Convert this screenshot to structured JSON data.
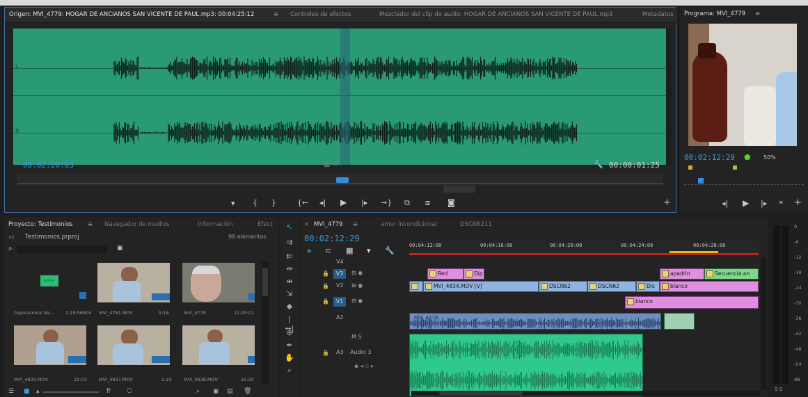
{
  "source": {
    "tabs": [
      {
        "label": "Origen: MVI_4779: HOGAR DE ANCIANOS SAN VICENTE DE PAUL.mp3: 00:04:25:12",
        "active": true
      },
      {
        "label": "Controles de efectos",
        "active": false
      },
      {
        "label": "Mezclador del clip de audio: HOGAR DE ANCIANOS SAN VICENTE DE PAUL.mp3",
        "active": false
      },
      {
        "label": "Metadatos",
        "active": false
      }
    ],
    "menu_icon": "≡",
    "channel_labels": [
      "L",
      "R"
    ],
    "timecode_left": "00:02:20:03",
    "timecode_right": "00:00:01:25",
    "waveform_color": "#2a9a76"
  },
  "program": {
    "tab": "Programa: MVI_4779",
    "menu_icon": "≡",
    "timecode": "00:02:12:29",
    "zoom": "50%"
  },
  "project": {
    "tabs": [
      {
        "label": "Proyecto: Testimonios",
        "active": true
      },
      {
        "label": "Navegador de medios",
        "active": false
      },
      {
        "label": "Información",
        "active": false
      },
      {
        "label": "Efect",
        "active": false
      }
    ],
    "menu_icon": "≡",
    "file": "Testimonios.prproj",
    "count": "98 elementos",
    "items": [
      {
        "name": "Depinational Ba...",
        "duration": "2:19:06804"
      },
      {
        "name": "MVI_4781.MOV",
        "duration": "9:18"
      },
      {
        "name": "MVI_4779",
        "duration": "12:25:01"
      },
      {
        "name": "MVI_4834.MOV",
        "duration": "22:03"
      },
      {
        "name": "MVI_4837.MOV",
        "duration": "2:23"
      },
      {
        "name": "MVI_4838.MOV",
        "duration": "15:20"
      }
    ]
  },
  "timeline": {
    "tabs": [
      {
        "label": "MVI_4779",
        "active": true
      },
      {
        "label": "amor incondicional",
        "active": false
      },
      {
        "label": "DSCN6211",
        "active": false
      }
    ],
    "close_icon": "×",
    "menu_icon": "≡",
    "timecode": "00:02:12:29",
    "ruler": [
      "00:04:12:00",
      "00:04:16:00",
      "00:04:20:00",
      "00:04:24:00",
      "00:04:28:00"
    ],
    "tracks": [
      {
        "name": "V4"
      },
      {
        "name": "V3"
      },
      {
        "name": "V2"
      },
      {
        "name": "V1"
      },
      {
        "name": "A2"
      },
      {
        "name": "A3",
        "label": "Audio 3"
      }
    ],
    "mute_solo": "M S",
    "clips": {
      "red": "Red",
      "dip": "Dip",
      "apadrin": "apadrin",
      "secuencia": "Secuencia an",
      "mvi_4834": "MVI_4834.MOV [V]",
      "dscn62a": "DSCN62",
      "dscn62b": "DSCN62",
      "dis": "Dis",
      "blanco_v2": "blanco",
      "blanco_v1": "blanco",
      "a2_label": "MVI_4779"
    }
  },
  "meters": {
    "scale": [
      "0",
      "-6",
      "-12",
      "-18",
      "-24",
      "-30",
      "-36",
      "-42",
      "-48",
      "-54",
      "dB"
    ],
    "solo": "S S"
  }
}
